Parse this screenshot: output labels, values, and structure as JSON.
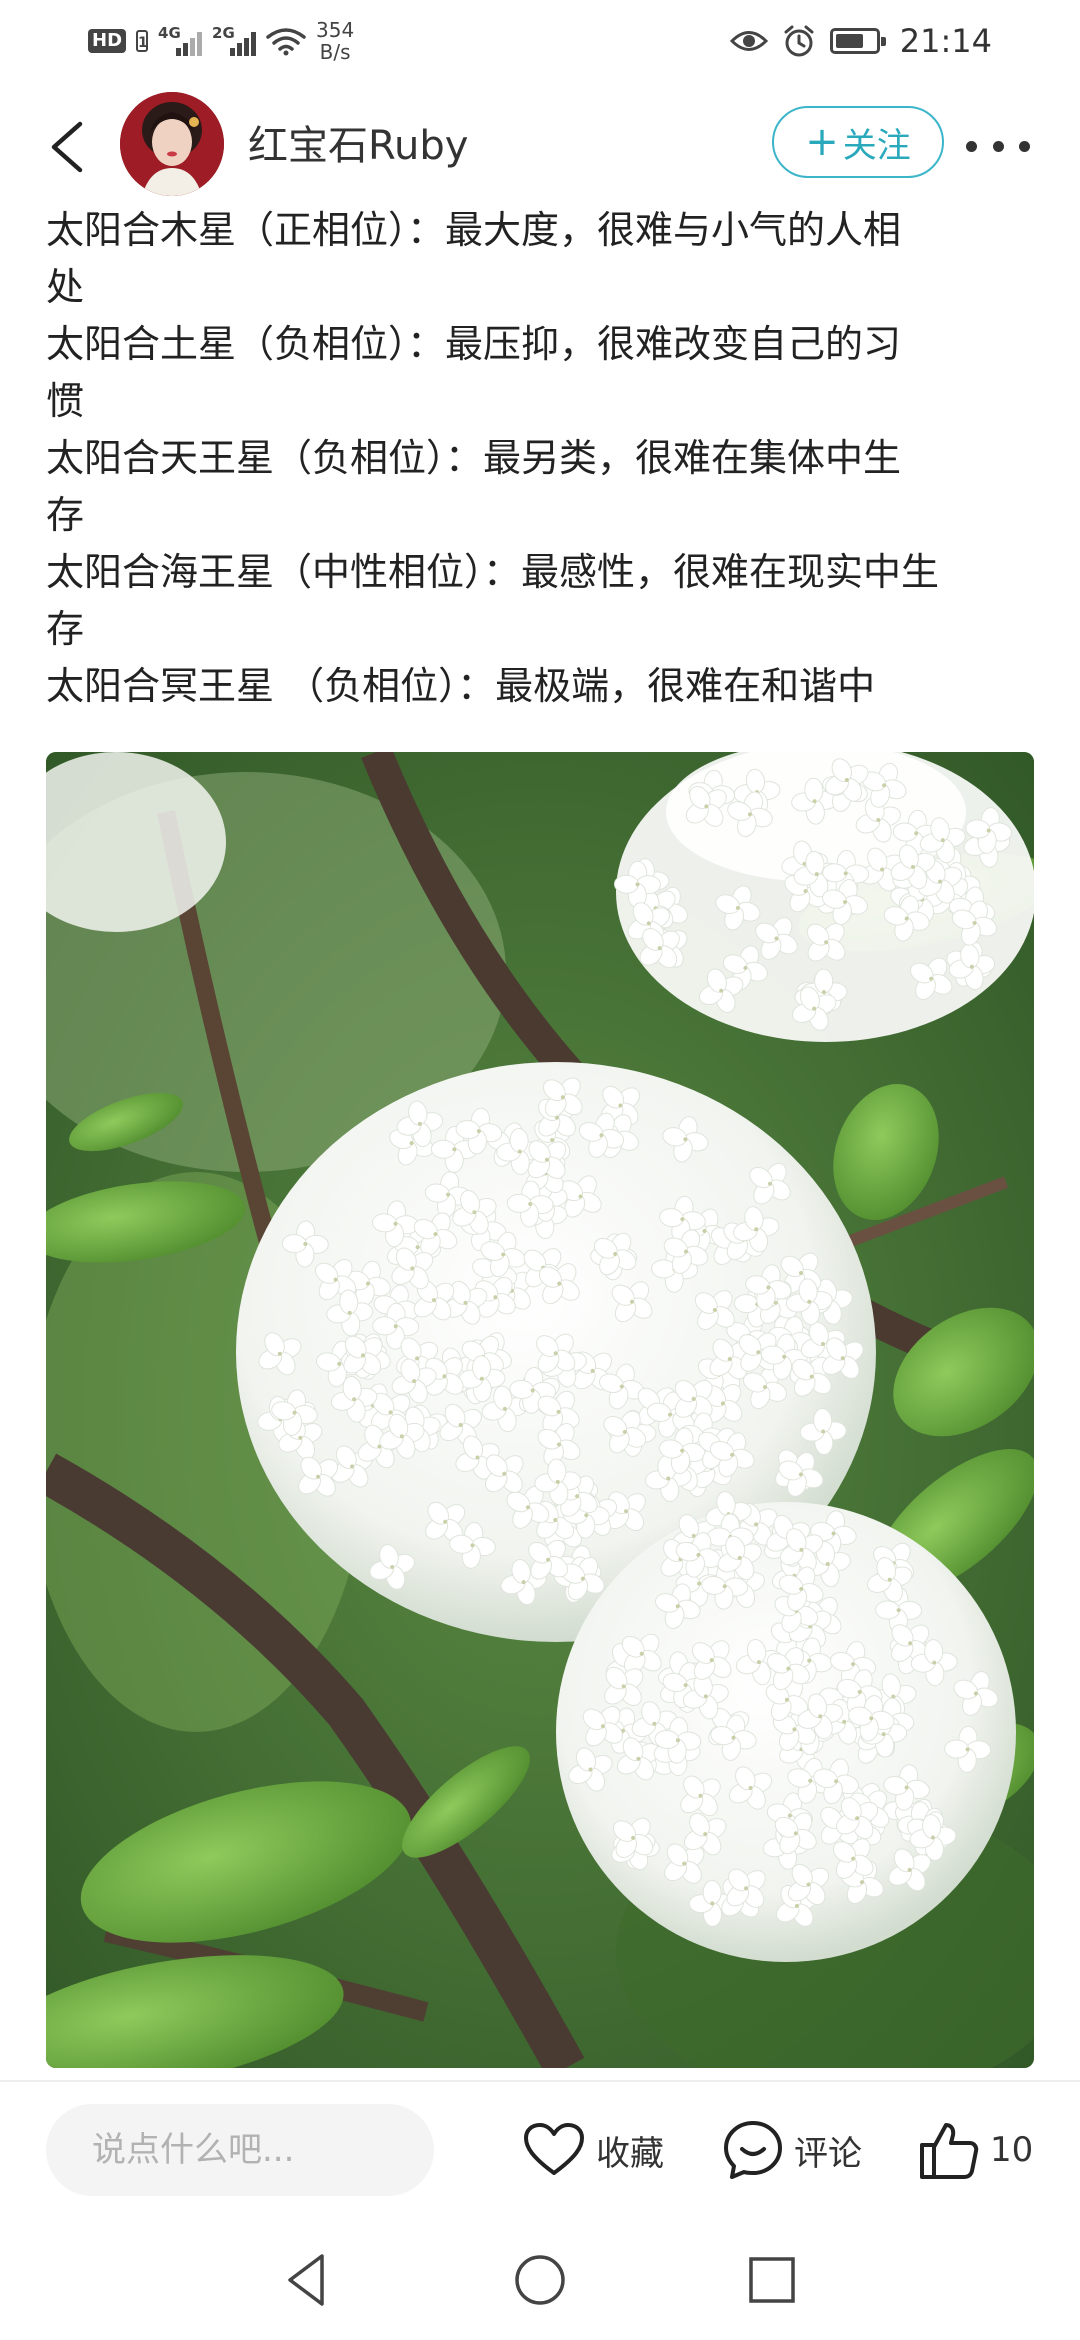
{
  "status_bar": {
    "hd_label": "HD",
    "sim_label": "1",
    "signal_1_label": "4G",
    "signal_2_label": "2G",
    "net_speed_value": "354",
    "net_speed_unit": "B/s",
    "time": "21:14",
    "battery_level": 0.7,
    "icons": [
      "eye-icon",
      "alarm-icon",
      "battery-icon",
      "wifi-icon",
      "signal-icon"
    ]
  },
  "header": {
    "username": "红宝石Ruby",
    "follow_label": "关注",
    "follow_plus": "+",
    "icons": [
      "back-arrow-icon",
      "more-icon"
    ]
  },
  "post": {
    "lines": [
      "太阳合木星（正相位）：最大度，很难与小气的人相",
      "处",
      "太阳合土星（负相位）：最压抑，很难改变自己的习",
      "惯",
      "太阳合天王星（负相位）：最另类，很难在集体中生",
      "存",
      "太阳合海王星（中性相位）：最感性，很难在现实中生",
      "存",
      "太阳合冥王星 （负相位）：最极端，很难在和谐中"
    ]
  },
  "photo": {
    "subject": "white-hydrangea-flowers"
  },
  "actions": {
    "comment_placeholder": "说点什么吧...",
    "favorite_label": "收藏",
    "comment_label": "评论",
    "like_count": "10",
    "icons": [
      "heart-icon",
      "comment-bubble-icon",
      "thumbs-up-icon"
    ]
  },
  "nav": {
    "icons": [
      "nav-back-icon",
      "nav-home-icon",
      "nav-recent-icon"
    ]
  },
  "colors": {
    "accent": "#2aa9bd",
    "text": "#222222",
    "input_bg": "#f4f4f4"
  }
}
